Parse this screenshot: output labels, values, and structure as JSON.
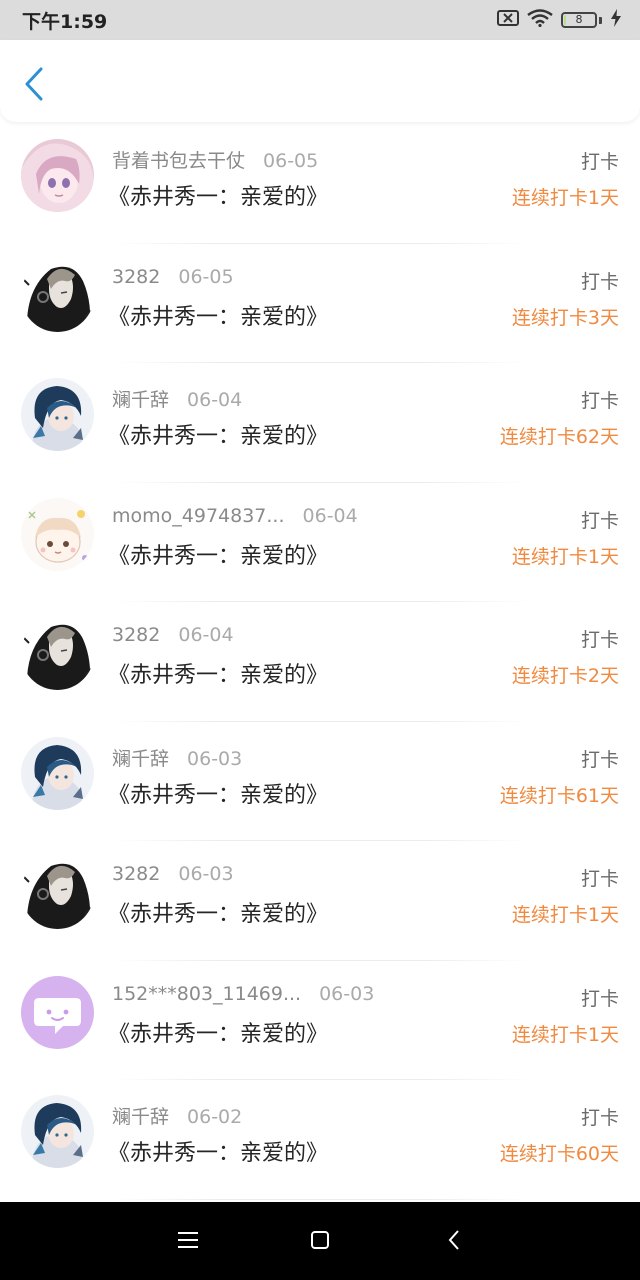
{
  "status_bar": {
    "time": "下午1:59",
    "battery_level": "8",
    "battery_fraction": 0.08
  },
  "header": {
    "back_icon": "chevron-left-icon",
    "accent_color": "#2d8fd5"
  },
  "list": {
    "action_label": "打卡",
    "streak_color": "#f08a40",
    "items": [
      {
        "username": "背着书包去干仗",
        "date": "06-05",
        "title": "《赤井秀一：亲爱的》",
        "action": "打卡",
        "streak": "连续打卡1天",
        "avatar": "anime-girl-avatar"
      },
      {
        "username": "3282",
        "date": "06-05",
        "title": "《赤井秀一：亲爱的》",
        "action": "打卡",
        "streak": "连续打卡3天",
        "avatar": "hooded-man-avatar"
      },
      {
        "username": "斓千辞",
        "date": "06-04",
        "title": "《赤井秀一：亲爱的》",
        "action": "打卡",
        "streak": "连续打卡62天",
        "avatar": "blue-haired-avatar"
      },
      {
        "username": "momo_4974837...",
        "date": "06-04",
        "title": "《赤井秀一：亲爱的》",
        "action": "打卡",
        "streak": "连续打卡1天",
        "avatar": "chibi-avatar"
      },
      {
        "username": "3282",
        "date": "06-04",
        "title": "《赤井秀一：亲爱的》",
        "action": "打卡",
        "streak": "连续打卡2天",
        "avatar": "hooded-man-avatar"
      },
      {
        "username": "斓千辞",
        "date": "06-03",
        "title": "《赤井秀一：亲爱的》",
        "action": "打卡",
        "streak": "连续打卡61天",
        "avatar": "blue-haired-avatar"
      },
      {
        "username": "3282",
        "date": "06-03",
        "title": "《赤井秀一：亲爱的》",
        "action": "打卡",
        "streak": "连续打卡1天",
        "avatar": "hooded-man-avatar"
      },
      {
        "username": "152***803_11469...",
        "date": "06-03",
        "title": "《赤井秀一：亲爱的》",
        "action": "打卡",
        "streak": "连续打卡1天",
        "avatar": "chat-bubble-avatar"
      },
      {
        "username": "斓千辞",
        "date": "06-02",
        "title": "《赤井秀一：亲爱的》",
        "action": "打卡",
        "streak": "连续打卡60天",
        "avatar": "blue-haired-avatar"
      }
    ]
  },
  "nav_bar": {
    "menu_icon": "menu-icon",
    "home_icon": "home-square-icon",
    "back_icon": "back-triangle-icon"
  }
}
